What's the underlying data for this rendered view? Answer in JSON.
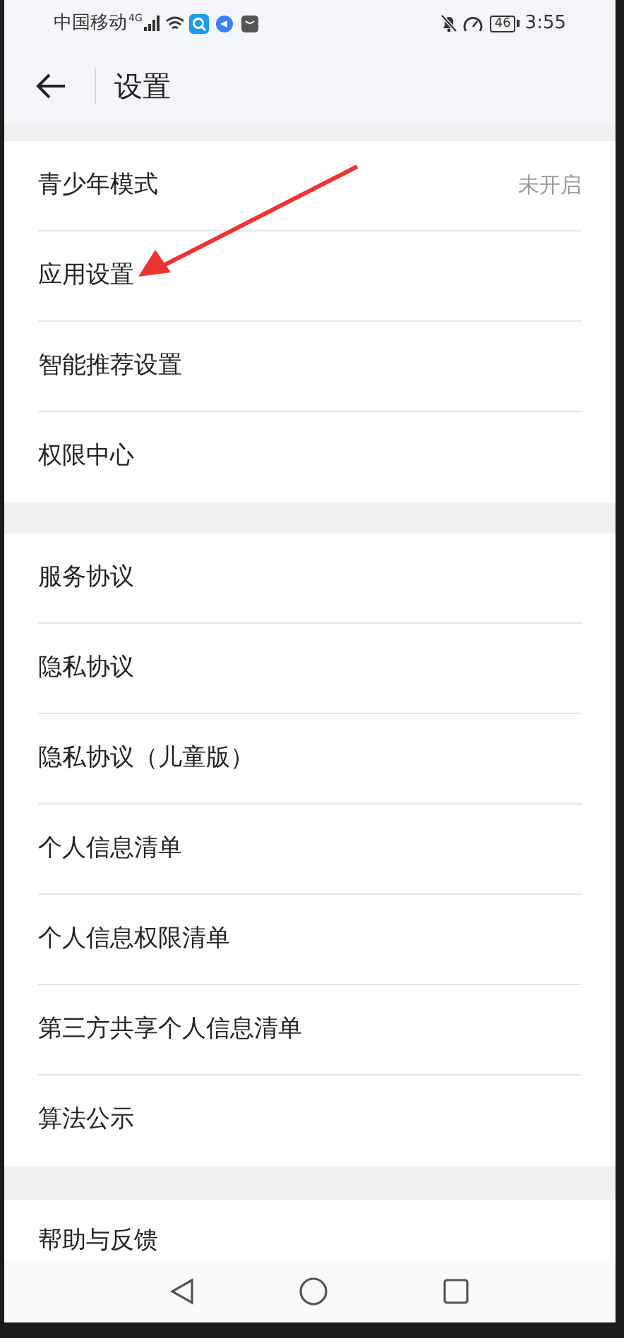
{
  "status_bar": {
    "carrier": "中国移动",
    "network": "4G",
    "battery": "46",
    "time": "3:55"
  },
  "header": {
    "title": "设置"
  },
  "sections": [
    {
      "items": [
        {
          "label": "青少年模式",
          "value": "未开启"
        },
        {
          "label": "应用设置"
        },
        {
          "label": "智能推荐设置"
        },
        {
          "label": "权限中心"
        }
      ]
    },
    {
      "items": [
        {
          "label": "服务协议"
        },
        {
          "label": "隐私协议"
        },
        {
          "label": "隐私协议（儿童版）"
        },
        {
          "label": "个人信息清单"
        },
        {
          "label": "个人信息权限清单"
        },
        {
          "label": "第三方共享个人信息清单"
        },
        {
          "label": "算法公示"
        }
      ]
    },
    {
      "items": [
        {
          "label": "帮助与反馈"
        }
      ]
    }
  ]
}
